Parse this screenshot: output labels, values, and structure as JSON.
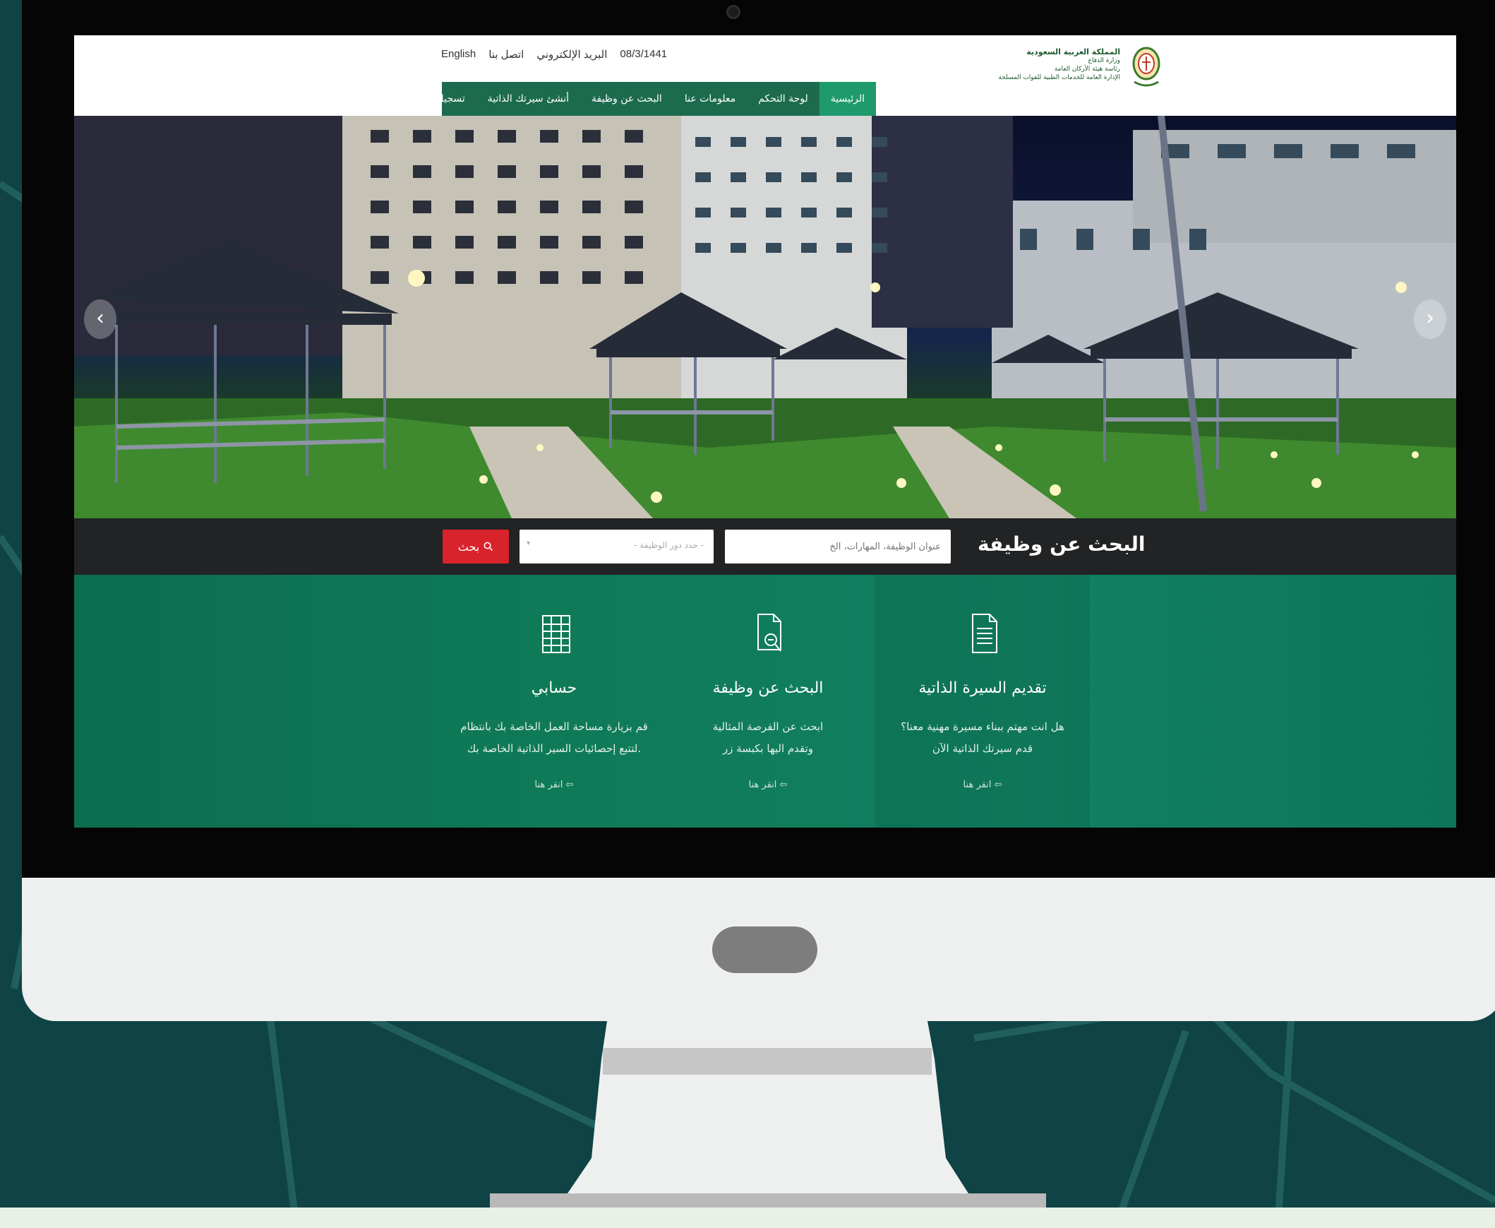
{
  "header": {
    "top_links": [
      "English",
      "اتصل بنا",
      "البريد الإلكتروني",
      "08/3/1441"
    ],
    "nav": [
      {
        "label": "الرئيسية",
        "active": true
      },
      {
        "label": "لوحة التحكم",
        "active": false
      },
      {
        "label": "معلومات عنا",
        "active": false
      },
      {
        "label": "البحث عن وظيفة",
        "active": false
      },
      {
        "label": "أنشئ سيرتك الذاتية",
        "active": false
      },
      {
        "label": "تسجيل الدخول",
        "active": false
      }
    ],
    "brand": {
      "line1": "المملكة العربية السعودية",
      "line2": "وزارة الدفاع",
      "line3": "رئاسة هيئة الأركان العامة",
      "line4": "الإدارة العامة للخدمات الطبية للقوات المسلحة"
    }
  },
  "hero": {
    "prev_icon": "‹",
    "next_icon": "›"
  },
  "search": {
    "title": "البحث عن وظيفة",
    "keyword_placeholder": "عنوان الوظيفة، المهارات، الخ",
    "select_placeholder": "- حدد دور الوظيفة -",
    "button_label": "بحث"
  },
  "features": [
    {
      "title": "تقديم السيرة الذاتية",
      "line1": "هل انت مهتم ببناء مسيرة مهنية معنا؟",
      "line2": "قدم سيرتك الذاتية الآن",
      "link": "انقر هنا"
    },
    {
      "title": "البحث عن وظيفة",
      "line1": "ابحث عن الفرصة المثالية",
      "line2": "وتقدم اليها بكبسة زر",
      "link": "انقر هنا"
    },
    {
      "title": "حسابي",
      "line1": "قم بزيارة مساحة العمل الخاصة بك بانتظام",
      "line2": "لتتبع إحصائيات السير الذاتية الخاصة بك.",
      "link": "انقر هنا"
    }
  ],
  "colors": {
    "nav_green": "#1d6b4e",
    "nav_active": "#1e9a6d",
    "search_red": "#d9232b",
    "feature_green": "#0f7a58",
    "page_bg": "#0f4345"
  }
}
